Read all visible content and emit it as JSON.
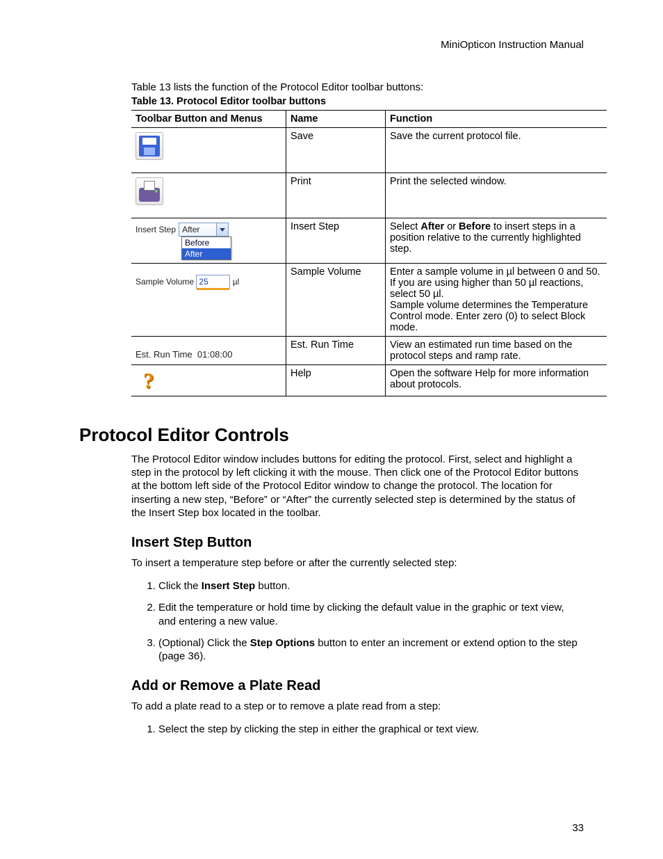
{
  "header": {
    "running": "MiniOpticon Instruction Manual"
  },
  "intro": "Table 13 lists the function of the Protocol Editor toolbar buttons:",
  "table": {
    "caption": "Table 13. Protocol Editor toolbar buttons",
    "head": {
      "c0": "Toolbar Button and Menus",
      "c1": "Name",
      "c2": "Function"
    },
    "rows": [
      {
        "name": "Save",
        "func": "Save the current protocol file."
      },
      {
        "name": "Print",
        "func": "Print the selected window."
      },
      {
        "name": "Insert Step",
        "func_pre": "Select ",
        "func_b1": "After",
        "func_mid": " or ",
        "func_b2": "Before",
        "func_post": " to insert steps in a position relative to the currently highlighted step."
      },
      {
        "name": "Sample Volume",
        "func": "Enter a sample volume in µl between 0 and 50. If you are using higher than 50 µl reactions, select 50 µl.\nSample volume determines the Temperature Control mode. Enter zero (0) to select Block mode."
      },
      {
        "name": "Est. Run Time",
        "func": "View an estimated run time based on the protocol steps and ramp rate."
      },
      {
        "name": "Help",
        "func": "Open the software Help for more information about protocols."
      }
    ]
  },
  "widgets": {
    "insert_step": {
      "label": "Insert Step",
      "selected": "After",
      "options": [
        "Before",
        "After"
      ]
    },
    "sample_volume": {
      "label": "Sample Volume",
      "value": "25",
      "unit": "µl"
    },
    "est_run_time": {
      "label": "Est. Run Time",
      "value": "01:08:00"
    }
  },
  "section": {
    "title": "Protocol Editor Controls",
    "para": "The Protocol Editor window includes buttons for editing the protocol. First, select and highlight a step in the protocol by left clicking it with the mouse. Then click one of the Protocol Editor buttons at the bottom left side of the Protocol Editor window to change the protocol. The location for inserting a new step, “Before” or “After” the currently selected step is determined by the status of the Insert Step box located in the toolbar."
  },
  "sub1": {
    "title": "Insert Step Button",
    "lead": "To insert a temperature step before or after the currently selected step:",
    "steps": {
      "s1_pre": "Click the ",
      "s1_b": "Insert Step",
      "s1_post": " button.",
      "s2": "Edit the temperature or hold time by clicking the default value in the graphic or text view, and entering a new value.",
      "s3_pre": "(Optional) Click the ",
      "s3_b": "Step Options",
      "s3_post": " button to enter an increment or extend option to the step (page 36)."
    }
  },
  "sub2": {
    "title": "Add or Remove a Plate Read",
    "lead": "To add a plate read to a step or to remove a plate read from a step:",
    "steps": {
      "s1": "Select the step by clicking the step in either the graphical or text view."
    }
  },
  "pagenum": "33"
}
